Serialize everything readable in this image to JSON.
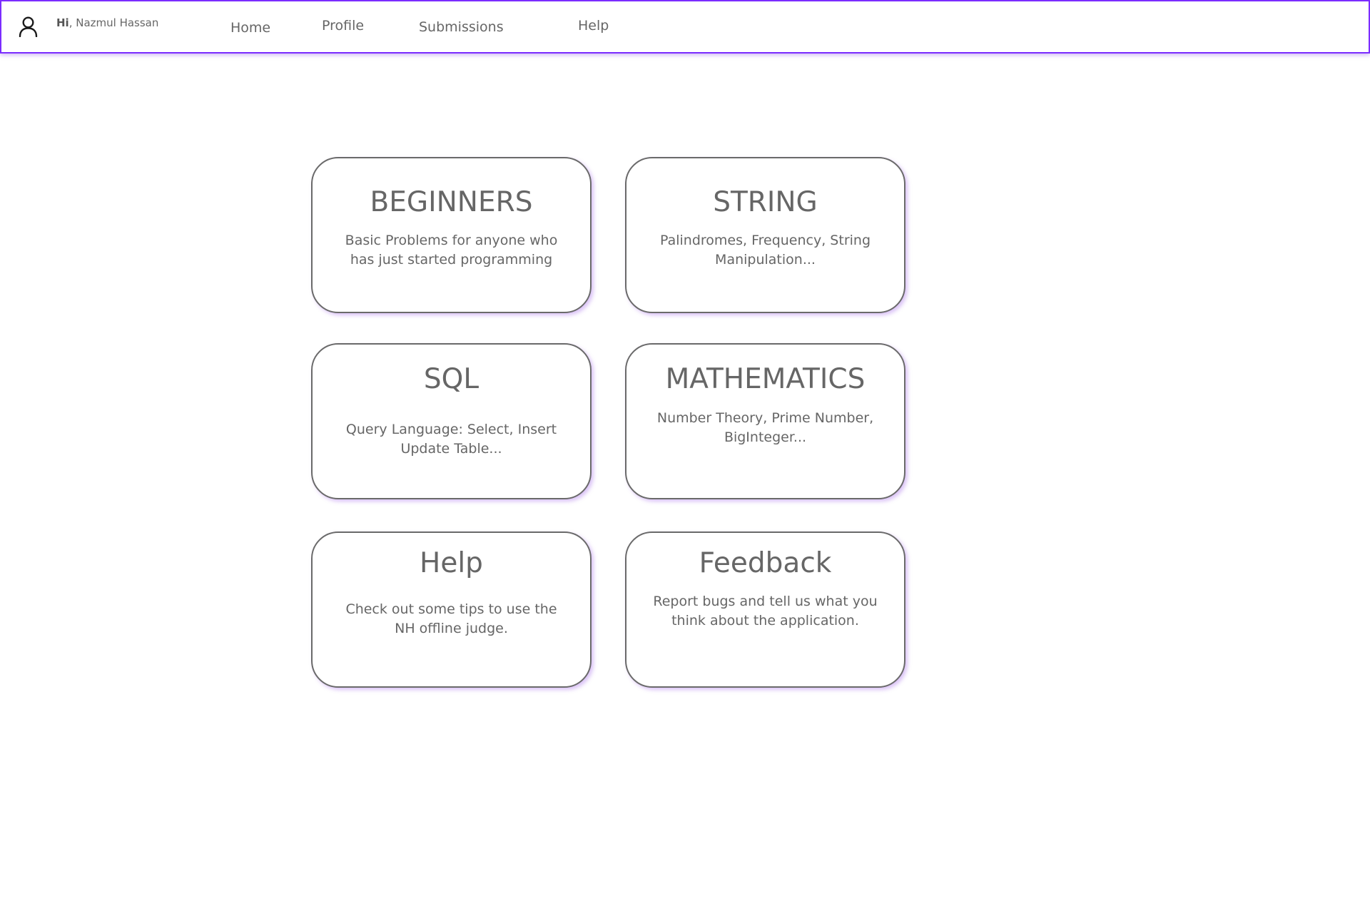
{
  "header": {
    "greeting_prefix": "Hi",
    "greeting_name": ", Nazmul Hassan",
    "icon": "user-icon",
    "accent_color": "#7b2cff"
  },
  "nav": {
    "home": "Home",
    "profile": "Profile",
    "submissions": "Submissions",
    "help": "Help"
  },
  "cards": [
    {
      "title": "BEGINNERS",
      "desc_line1": "Basic Problems for anyone who",
      "desc_line2": "has just started programming"
    },
    {
      "title": "STRING",
      "desc_line1": "Palindromes, Frequency, String",
      "desc_line2": "Manipulation..."
    },
    {
      "title": "SQL",
      "desc_line1": "Query Language: Select, Insert",
      "desc_line2": "Update Table..."
    },
    {
      "title": "MATHEMATICS",
      "desc_line1": "Number Theory, Prime Number,",
      "desc_line2": "BigInteger..."
    },
    {
      "title": "Help",
      "desc_line1": "Check out some tips to use the",
      "desc_line2": "NH offline judge."
    },
    {
      "title": "Feedback",
      "desc_line1": "Report bugs and tell us what you",
      "desc_line2": "think about the application."
    }
  ]
}
